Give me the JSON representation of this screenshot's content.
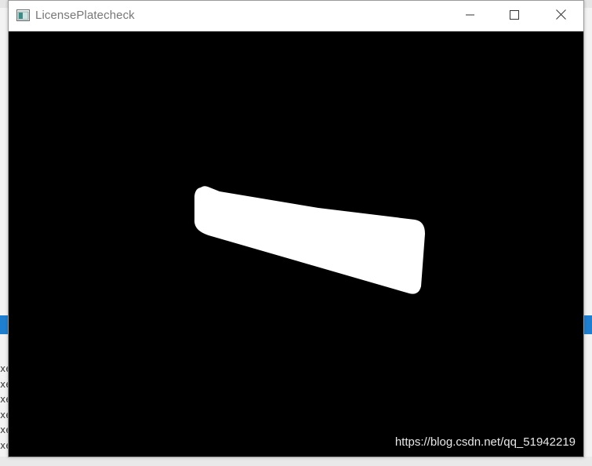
{
  "window": {
    "title": "LicensePlatecheck",
    "controls": {
      "minimize_icon": "minimize-icon",
      "maximize_icon": "maximize-icon",
      "close_icon": "close-icon"
    }
  },
  "canvas": {
    "background": "#000000",
    "mask_color": "#ffffff"
  },
  "watermark": "https://blog.csdn.net/qq_51942219",
  "background_app": {
    "accent": "#1e7fd1",
    "console_lines": [
      "xe",
      "xe",
      "xe",
      "xe",
      "xe",
      "xe"
    ]
  }
}
